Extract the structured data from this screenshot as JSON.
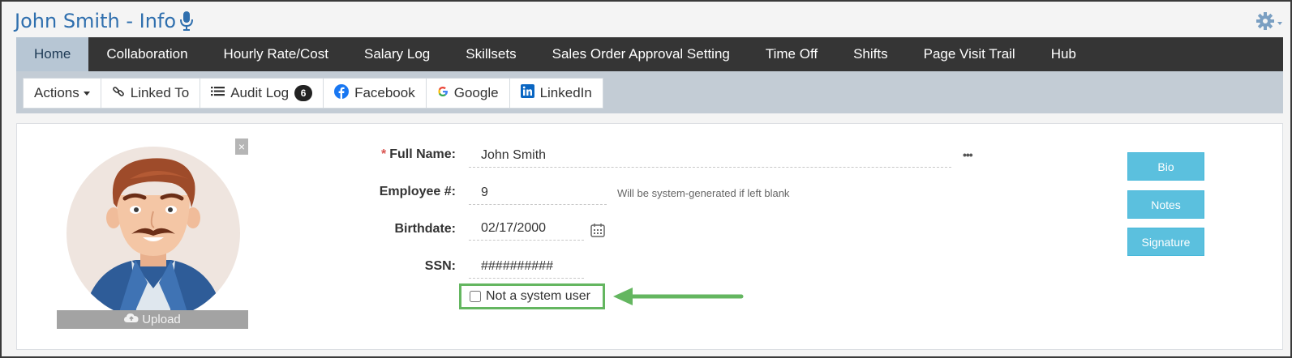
{
  "header": {
    "title": "John Smith - Info",
    "mic_icon": "microphone-icon",
    "settings_icon": "gear-icon"
  },
  "nav": {
    "tabs": [
      {
        "label": "Home",
        "active": true
      },
      {
        "label": "Collaboration"
      },
      {
        "label": "Hourly Rate/Cost"
      },
      {
        "label": "Salary Log"
      },
      {
        "label": "Skillsets"
      },
      {
        "label": "Sales Order Approval Setting"
      },
      {
        "label": "Time Off"
      },
      {
        "label": "Shifts"
      },
      {
        "label": "Page Visit Trail"
      },
      {
        "label": "Hub"
      }
    ]
  },
  "toolbar": {
    "actions": "Actions",
    "linked_to": "Linked To",
    "audit_log": "Audit Log",
    "audit_count": "6",
    "facebook": "Facebook",
    "google": "Google",
    "linkedin": "LinkedIn"
  },
  "profile": {
    "close": "×",
    "upload": "Upload"
  },
  "form": {
    "full_name_label": "Full Name:",
    "required_mark": "*",
    "full_name_value": "John Smith",
    "more": "•••",
    "employee_label": "Employee #:",
    "employee_value": "9",
    "employee_hint": "Will be system-generated if left blank",
    "birthdate_label": "Birthdate:",
    "birthdate_value": "02/17/2000",
    "ssn_label": "SSN:",
    "ssn_value": "##########",
    "not_system_user": "Not a system user"
  },
  "side_buttons": {
    "bio": "Bio",
    "notes": "Notes",
    "signature": "Signature"
  },
  "colors": {
    "title": "#2f6fae",
    "navbar": "#353535",
    "active_tab": "#b7c6d4",
    "side_button": "#5bc0de",
    "highlight": "#64b660"
  }
}
